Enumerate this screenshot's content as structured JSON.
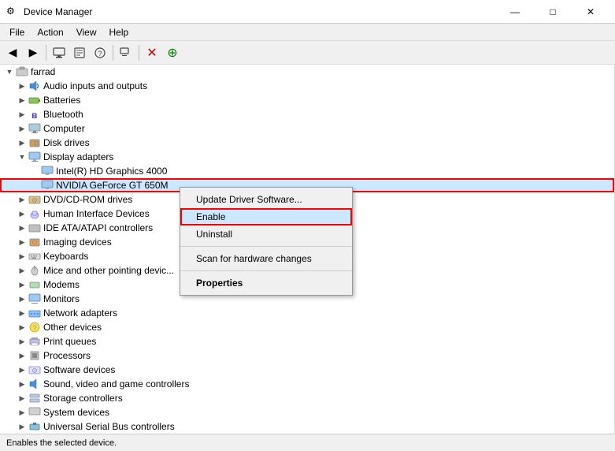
{
  "title_bar": {
    "icon": "⚙",
    "title": "Device Manager",
    "minimize": "—",
    "maximize": "□",
    "close": "✕"
  },
  "menu": {
    "items": [
      "File",
      "Action",
      "View",
      "Help"
    ]
  },
  "toolbar": {
    "buttons": [
      "◀",
      "▶",
      "⬛",
      "🔑",
      "📷",
      "📋",
      "✕",
      "🟢"
    ]
  },
  "tree": {
    "root": "farrad",
    "items": [
      {
        "id": "audio",
        "label": "Audio inputs and outputs",
        "indent": 2,
        "expanded": false,
        "icon": "🔊"
      },
      {
        "id": "batteries",
        "label": "Batteries",
        "indent": 2,
        "expanded": false,
        "icon": "🔋"
      },
      {
        "id": "bluetooth",
        "label": "Bluetooth",
        "indent": 2,
        "expanded": false,
        "icon": "🔵"
      },
      {
        "id": "computer",
        "label": "Computer",
        "indent": 2,
        "expanded": false,
        "icon": "💻"
      },
      {
        "id": "disk",
        "label": "Disk drives",
        "indent": 2,
        "expanded": false,
        "icon": "💾"
      },
      {
        "id": "display",
        "label": "Display adapters",
        "indent": 2,
        "expanded": true,
        "icon": "🖥"
      },
      {
        "id": "intel",
        "label": "Intel(R) HD Graphics 4000",
        "indent": 3,
        "expanded": false,
        "icon": "🖥"
      },
      {
        "id": "nvidia",
        "label": "NVIDIA GeForce GT 650M",
        "indent": 3,
        "expanded": false,
        "icon": "🖥",
        "selected": true,
        "redborder": true
      },
      {
        "id": "dvd",
        "label": "DVD/CD-ROM drives",
        "indent": 2,
        "expanded": false,
        "icon": "💿"
      },
      {
        "id": "hid",
        "label": "Human Interface Devices",
        "indent": 2,
        "expanded": false,
        "icon": "🖱"
      },
      {
        "id": "ide",
        "label": "IDE ATA/ATAPI controllers",
        "indent": 2,
        "expanded": false,
        "icon": "💾"
      },
      {
        "id": "imaging",
        "label": "Imaging devices",
        "indent": 2,
        "expanded": false,
        "icon": "📷"
      },
      {
        "id": "keyboards",
        "label": "Keyboards",
        "indent": 2,
        "expanded": false,
        "icon": "⌨"
      },
      {
        "id": "mice",
        "label": "Mice and other pointing devic...",
        "indent": 2,
        "expanded": false,
        "icon": "🖱"
      },
      {
        "id": "modems",
        "label": "Modems",
        "indent": 2,
        "expanded": false,
        "icon": "📡"
      },
      {
        "id": "monitors",
        "label": "Monitors",
        "indent": 2,
        "expanded": false,
        "icon": "🖥"
      },
      {
        "id": "network",
        "label": "Network adapters",
        "indent": 2,
        "expanded": false,
        "icon": "🌐"
      },
      {
        "id": "other",
        "label": "Other devices",
        "indent": 2,
        "expanded": false,
        "icon": "❓"
      },
      {
        "id": "print",
        "label": "Print queues",
        "indent": 2,
        "expanded": false,
        "icon": "🖨"
      },
      {
        "id": "processors",
        "label": "Processors",
        "indent": 2,
        "expanded": false,
        "icon": "⚙"
      },
      {
        "id": "software",
        "label": "Software devices",
        "indent": 2,
        "expanded": false,
        "icon": "💿"
      },
      {
        "id": "sound",
        "label": "Sound, video and game controllers",
        "indent": 2,
        "expanded": false,
        "icon": "🔊"
      },
      {
        "id": "storage",
        "label": "Storage controllers",
        "indent": 2,
        "expanded": false,
        "icon": "💾"
      },
      {
        "id": "system",
        "label": "System devices",
        "indent": 2,
        "expanded": false,
        "icon": "⚙"
      },
      {
        "id": "usb",
        "label": "Universal Serial Bus controllers",
        "indent": 2,
        "expanded": false,
        "icon": "🔌"
      }
    ]
  },
  "context_menu": {
    "items": [
      {
        "id": "update",
        "label": "Update Driver Software...",
        "bold": false,
        "separator_after": false
      },
      {
        "id": "enable",
        "label": "Enable",
        "bold": false,
        "active": true,
        "separator_after": false
      },
      {
        "id": "uninstall",
        "label": "Uninstall",
        "bold": false,
        "separator_after": true
      },
      {
        "id": "scan",
        "label": "Scan for hardware changes",
        "bold": false,
        "separator_after": true
      },
      {
        "id": "properties",
        "label": "Properties",
        "bold": true,
        "separator_after": false
      }
    ]
  },
  "status_bar": {
    "text": "Enables the selected device."
  }
}
